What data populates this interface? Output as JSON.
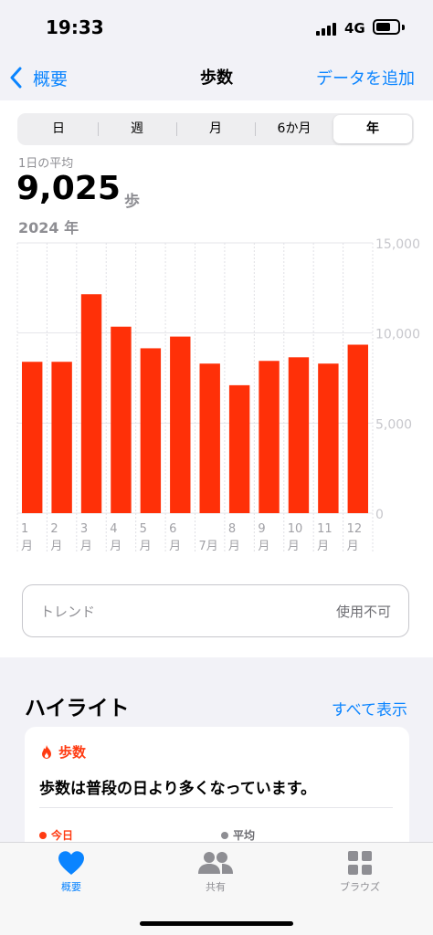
{
  "status": {
    "time": "19:33",
    "network": "4G"
  },
  "nav": {
    "back_label": "概要",
    "title": "歩数",
    "add_label": "データを追加"
  },
  "segments": [
    {
      "label": "日",
      "active": false
    },
    {
      "label": "週",
      "active": false
    },
    {
      "label": "月",
      "active": false
    },
    {
      "label": "6か月",
      "active": false
    },
    {
      "label": "年",
      "active": true
    }
  ],
  "summary": {
    "label": "1日の平均",
    "value": "9,025",
    "unit": "歩",
    "period": "2024 年"
  },
  "chart_data": {
    "type": "bar",
    "categories": [
      "1月",
      "2月",
      "3月",
      "4月",
      "5月",
      "6月",
      "7月",
      "8月",
      "9月",
      "10月",
      "11月",
      "12月"
    ],
    "values": [
      8400,
      8400,
      12150,
      10350,
      9150,
      9800,
      8300,
      7100,
      8450,
      8650,
      8300,
      9350
    ],
    "ylim": [
      0,
      15000
    ],
    "y_ticks": [
      "15,000",
      "10,000",
      "5,000",
      "0"
    ],
    "y_tick_values": [
      15000,
      10000,
      5000,
      0
    ],
    "x_top_labels": [
      "1",
      "2",
      "3",
      "4",
      "5",
      "6",
      "",
      "8",
      "9",
      "10",
      "11",
      "12"
    ],
    "x_bottom_labels": [
      "月",
      "月",
      "月",
      "月",
      "月",
      "月",
      "7月",
      "月",
      "月",
      "月",
      "月",
      "月"
    ],
    "bar_color": "#ff3008",
    "grid": true
  },
  "trend": {
    "label": "トレンド",
    "value": "使用不可"
  },
  "highlights": {
    "title": "ハイライト",
    "see_all": "すべて表示",
    "card": {
      "category": "歩数",
      "text": "歩数は普段の日より多くなっています。",
      "legend_today": "今日",
      "legend_avg": "平均"
    }
  },
  "tabs": [
    {
      "label": "概要",
      "icon": "heart-icon",
      "active": true
    },
    {
      "label": "共有",
      "icon": "people-icon",
      "active": false
    },
    {
      "label": "ブラウズ",
      "icon": "grid-icon",
      "active": false
    }
  ],
  "colors": {
    "accent": "#0a84ff",
    "steps": "#ff3b12",
    "tab_inactive": "#8e8e93"
  }
}
